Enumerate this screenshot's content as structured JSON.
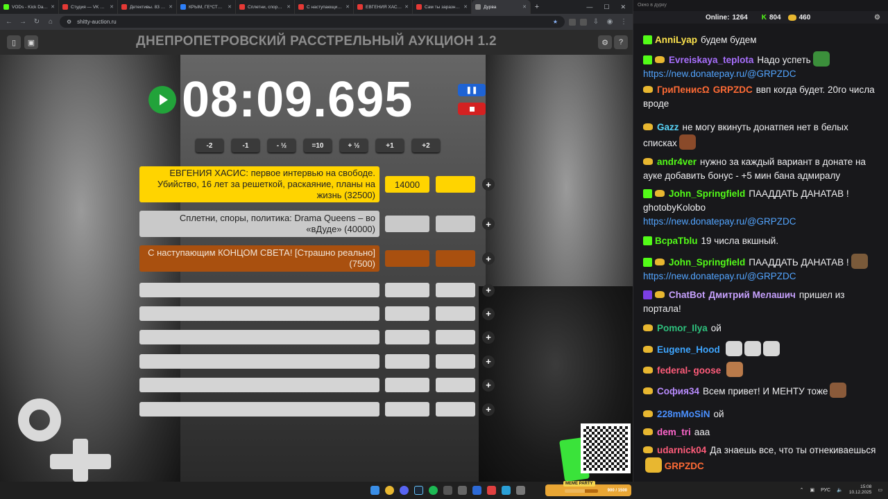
{
  "browser": {
    "tabs": [
      {
        "label": "VODs - Kick Dashb",
        "color": "#53fc18"
      },
      {
        "label": "Студия — VK Видео",
        "color": "#e53935"
      },
      {
        "label": "Детективы. 83 сер",
        "color": "#e53935"
      },
      {
        "label": "КРЫМ, ГЕ*СТВО В",
        "color": "#2d7ff9"
      },
      {
        "label": "Сплетни, споры, п",
        "color": "#e53935"
      },
      {
        "label": "С наступающим К",
        "color": "#e53935"
      },
      {
        "label": "ЕВГЕНИЯ ХАСИС:",
        "color": "#e53935"
      },
      {
        "label": "Сам ты заразный",
        "color": "#e53935"
      },
      {
        "label": "Дурва",
        "color": "#888888"
      }
    ],
    "url": "shitty-auction.ru"
  },
  "auction": {
    "title": "ДНЕПРОПЕТРОВСКИЙ РАССТРЕЛЬНЫЙ АУКЦИОН 1.2",
    "timer": "08:09.695",
    "time_buttons": [
      "-2",
      "-1",
      "- ½",
      "=10",
      "+ ½",
      "+1",
      "+2"
    ],
    "lots": [
      {
        "name": "ЕВГЕНИЯ ХАСИС: первое интервью на свободе. Убийство, 16 лет за решеткой, раскаяние, планы на жизнь (32500)",
        "amount": "14000",
        "color": "#ffd400"
      },
      {
        "name": "Сплетни, споры, политика: Drama Queens – во «вДуде» (40000)",
        "amount": "",
        "color": "#c9c9c9"
      },
      {
        "name": "С наступающим КОНЦОМ СВЕТА! [Страшно реально] (7500)",
        "amount": "",
        "color": "#a9500f"
      },
      {
        "name": "",
        "amount": "",
        "color": "#d4d4d4"
      },
      {
        "name": "",
        "amount": "",
        "color": "#d4d4d4"
      },
      {
        "name": "",
        "amount": "",
        "color": "#d4d4d4"
      },
      {
        "name": "",
        "amount": "",
        "color": "#d4d4d4"
      },
      {
        "name": "",
        "amount": "",
        "color": "#d4d4d4"
      },
      {
        "name": "",
        "amount": "",
        "color": "#d4d4d4"
      }
    ]
  },
  "chat": {
    "window_title": "Окно в дурку",
    "online_label": "Online:",
    "online_count": "1264",
    "kick_count": "804",
    "coin_count": "460",
    "messages": [
      {
        "nick": "AnniLyap",
        "nick_color": "#ffe54d",
        "badge": "#53fc18",
        "coin": false,
        "text": "будем будем",
        "link": "",
        "after": ""
      },
      {
        "nick": "Evreiskaya_teplota",
        "nick_color": "#a970ff",
        "badge": "#53fc18",
        "coin": true,
        "text": "Надо успеть",
        "link": "https://new.donatepay.ru/@GRPZDC",
        "after": ""
      },
      {
        "nick": "ГриПенисΩ",
        "nick_color": "#ff6b35",
        "badge": "",
        "coin": true,
        "text": "",
        "mention": "GRPZDC",
        "mention_color": "#ff6b35",
        "after": "ввп когда будет. 20го числа вроде",
        "link": ""
      },
      {
        "nick": "Gazz",
        "nick_color": "#58d3f7",
        "badge": "",
        "coin": true,
        "text": "не могу вкинуть донатпея нет в белых списках",
        "link": "",
        "after": ""
      },
      {
        "nick": "andr4ver",
        "nick_color": "#53fc18",
        "badge": "",
        "coin": true,
        "text": "нужно за каждый вариант в донате на ауке добавить бонус - +5 мин бана адмиралу",
        "link": "",
        "after": ""
      },
      {
        "nick": "John_Springfield",
        "nick_color": "#53fc18",
        "badge": "#53fc18",
        "coin": true,
        "text": "ПААДДАТЬ ДАНАТАВ ! ghotobyKolobo",
        "link": "https://new.donatepay.ru/@GRPZDC",
        "after": ""
      },
      {
        "nick": "BcpaTblu",
        "nick_color": "#53fc18",
        "badge": "#53fc18",
        "coin": false,
        "text": "19 числа вкшный.",
        "link": "",
        "after": ""
      },
      {
        "nick": "John_Springfield",
        "nick_color": "#53fc18",
        "badge": "#53fc18",
        "coin": true,
        "text": "ПААДДАТЬ ДАНАТАВ !",
        "link": "https://new.donatepay.ru/@GRPZDC",
        "after": ""
      },
      {
        "nick": "ChatBot",
        "nick_color": "#c8a2ff",
        "badge": "#7b3fe4",
        "coin": true,
        "text": "",
        "mention": "Дмитрий Мелашич",
        "mention_color": "#c8a2ff",
        "after": "пришел из портала!",
        "link": ""
      },
      {
        "nick": "Pomor_Ilya",
        "nick_color": "#2ec27e",
        "badge": "",
        "coin": true,
        "text": "ой",
        "link": "",
        "after": ""
      },
      {
        "nick": "Eugene_Hood",
        "nick_color": "#3ea6ff",
        "badge": "",
        "coin": true,
        "text": "",
        "link": "",
        "after": ""
      },
      {
        "nick": "federal- goose",
        "nick_color": "#ff5c7a",
        "badge": "",
        "coin": true,
        "text": "",
        "link": "",
        "after": ""
      },
      {
        "nick": "София34",
        "nick_color": "#b98cff",
        "badge": "",
        "coin": true,
        "text": "Всем привет! И МЕНТУ тоже",
        "link": "",
        "after": ""
      },
      {
        "nick": "228mMoSiN",
        "nick_color": "#4a90ff",
        "badge": "",
        "coin": true,
        "text": "ой",
        "link": "",
        "after": ""
      },
      {
        "nick": "dem_tri",
        "nick_color": "#ff66cc",
        "badge": "",
        "coin": true,
        "text": "ааа",
        "link": "",
        "after": ""
      },
      {
        "nick": "udarnick04",
        "nick_color": "#ff5c7a",
        "badge": "",
        "coin": true,
        "text": "Да знаешь все, что ты отнекиваешься",
        "link": "",
        "after": "",
        "mention": "GRPZDC",
        "mention_color": "#ff6b35",
        "mention_after": true
      }
    ]
  },
  "taskbar": {
    "meme_label": "MEME PARTY",
    "meme_progress": "900 / 1500",
    "meme_fraction": 0.6,
    "lang": "РУС",
    "time": "15:08",
    "date": "10.12.2025"
  }
}
